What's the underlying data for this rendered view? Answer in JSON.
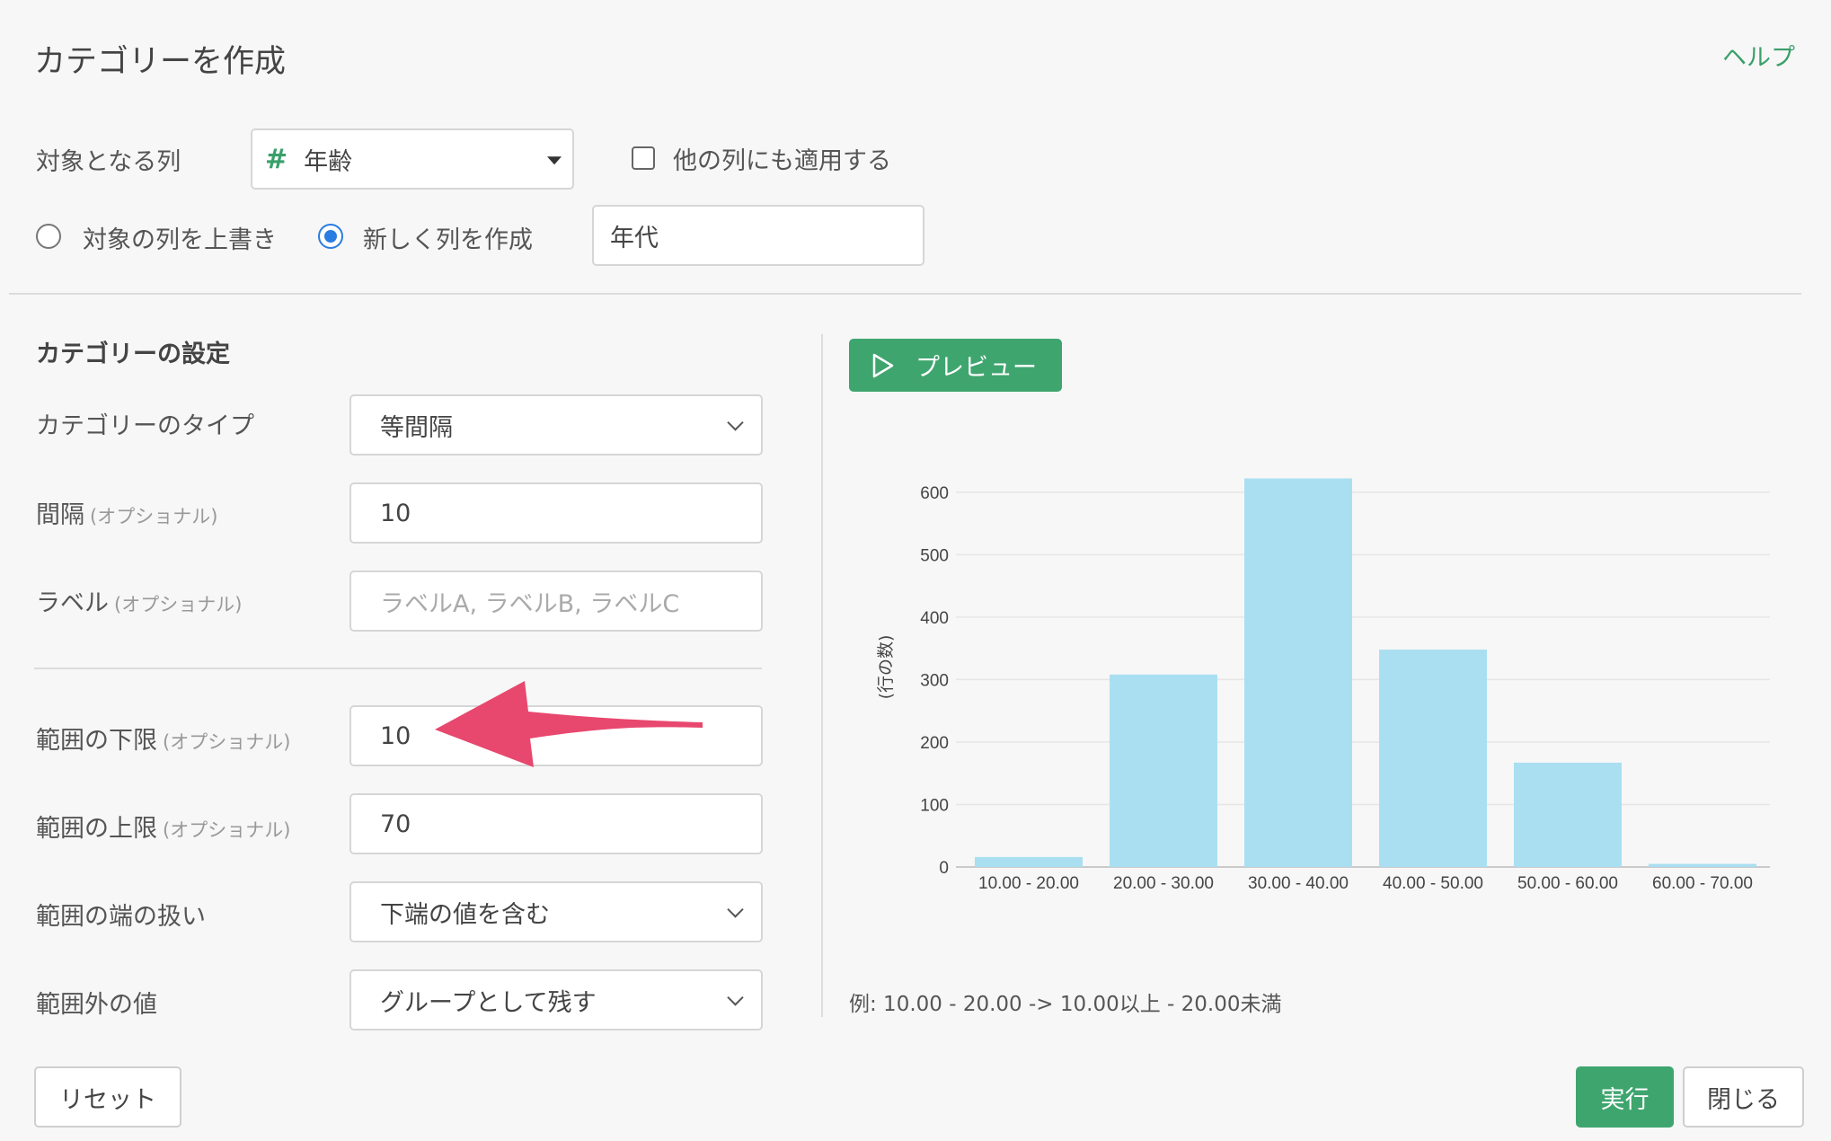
{
  "dialog": {
    "title": "カテゴリーを作成",
    "help": "ヘルプ"
  },
  "target": {
    "label": "対象となる列",
    "column_icon": "#",
    "column_value": "年齢",
    "apply_others": "他の列にも適用する",
    "apply_others_checked": false,
    "overwrite_label": "対象の列を上書き",
    "new_column_label": "新しく列を作成",
    "new_column_selected": true,
    "new_column_name": "年代"
  },
  "settings": {
    "section_title": "カテゴリーの設定",
    "type_label": "カテゴリーのタイプ",
    "type_value": "等間隔",
    "interval_label": "間隔",
    "optional": "(オプショナル)",
    "interval_value": "10",
    "labels_label": "ラベル",
    "labels_placeholder": "ラベルA, ラベルB, ラベルC",
    "lower_label": "範囲の下限",
    "lower_value": "10",
    "upper_label": "範囲の上限",
    "upper_value": "70",
    "edge_label": "範囲の端の扱い",
    "edge_value": "下端の値を含む",
    "outside_label": "範囲外の値",
    "outside_value": "グループとして残す"
  },
  "preview": {
    "button": "プレビュー",
    "example": "例: 10.00 - 20.00 -> 10.00以上 - 20.00未満"
  },
  "footer": {
    "reset": "リセット",
    "run": "実行",
    "close": "閉じる"
  },
  "colors": {
    "accent": "#3fa56f",
    "bar": "#aadff2",
    "arrow": "#e8476e",
    "radio": "#2a7de1"
  },
  "chart_data": {
    "type": "bar",
    "categories": [
      "10.00 - 20.00",
      "20.00 - 30.00",
      "30.00 - 40.00",
      "40.00 - 50.00",
      "50.00 - 60.00",
      "60.00 - 70.00"
    ],
    "values": [
      16,
      308,
      622,
      348,
      167,
      5
    ],
    "ylabel": "(行の数)",
    "ylim": [
      0,
      640
    ],
    "yticks": [
      0,
      100,
      200,
      300,
      400,
      500,
      600
    ],
    "grid": true
  }
}
